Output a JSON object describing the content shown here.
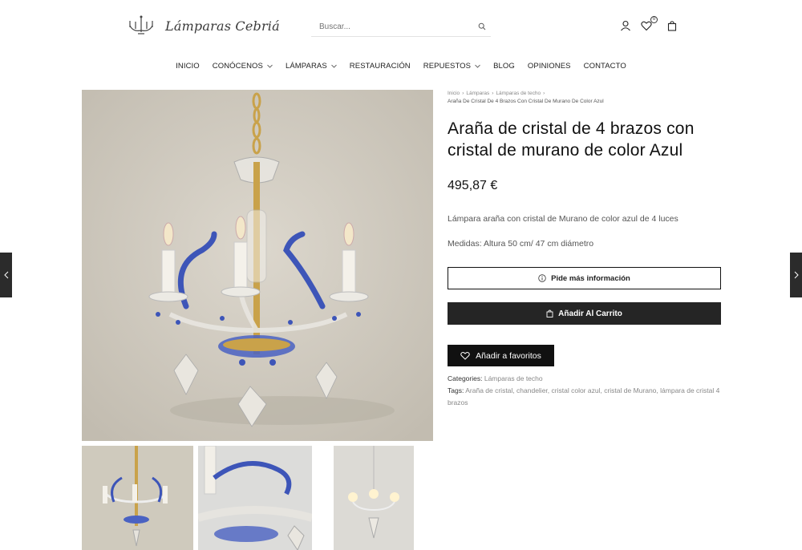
{
  "header": {
    "logo_text": "Lámparas Cebriá",
    "search_placeholder": "Buscar...",
    "wishlist_count": "0"
  },
  "nav": {
    "items": [
      {
        "label": "INICIO"
      },
      {
        "label": "CONÓCENOS"
      },
      {
        "label": "LÁMPARAS"
      },
      {
        "label": "RESTAURACIÓN"
      },
      {
        "label": "REPUESTOS"
      },
      {
        "label": "BLOG"
      },
      {
        "label": "OPINIONES"
      },
      {
        "label": "CONTACTO"
      }
    ]
  },
  "breadcrumb": {
    "items": [
      "Inicio",
      "Lámparas",
      "Lámparas de techo"
    ],
    "current": "Araña De Cristal De 4 Brazos Con Cristal De Murano De Color Azul"
  },
  "product": {
    "title": "Araña de cristal de 4 brazos con cristal de murano de color Azul",
    "price": "495,87 €",
    "description": "Lámpara araña con cristal de Murano de color azul de 4 luces",
    "measures": "Medidas: Altura 50 cm/ 47 cm diámetro",
    "info_button": "Pide más información",
    "cart_button": "Añadir Al Carrito",
    "favorites_button": "Añadir a favoritos",
    "categories_label": "Categories:",
    "categories": "Lámparas de techo",
    "tags_label": "Tags:",
    "tags": [
      "Araña de cristal",
      "chandelier",
      "cristal color azul",
      "cristal de Murano",
      "lámpara de cristal 4 brazos"
    ]
  },
  "colors": {
    "accent_dark": "#252525",
    "crystal_blue": "#3d55b8",
    "gold": "#c9a24a",
    "photo_background": "#cdc8bd"
  }
}
